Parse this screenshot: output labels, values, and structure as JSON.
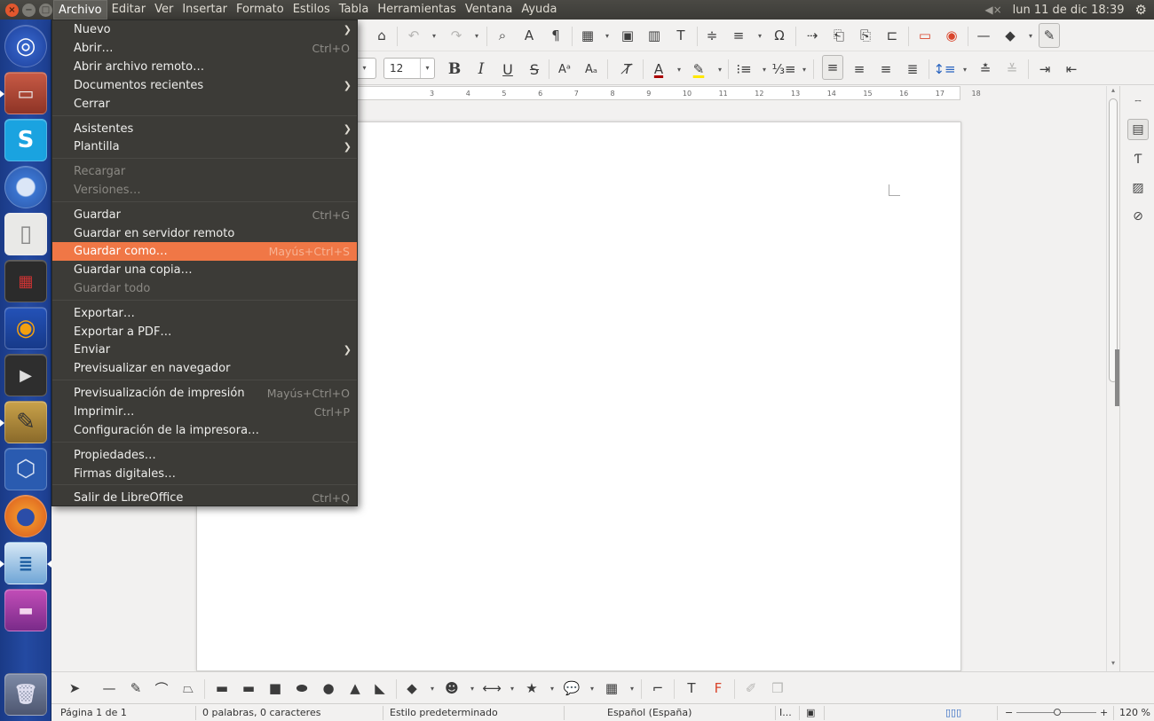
{
  "topbar": {
    "menus": [
      "Archivo",
      "Editar",
      "Ver",
      "Insertar",
      "Formato",
      "Estilos",
      "Tabla",
      "Herramientas",
      "Ventana",
      "Ayuda"
    ],
    "clock": "lun 11 de dic 18:39"
  },
  "launcher": {
    "apps": [
      "ubuntu-dash",
      "files",
      "skype",
      "chromium",
      "text-editor",
      "video-editor",
      "audacity",
      "video-player",
      "gimp",
      "virtualbox",
      "firefox",
      "libreoffice-writer",
      "libreoffice-impress",
      "trash"
    ]
  },
  "toolbar": {
    "font_size": "12"
  },
  "ruler": {
    "ticks": [
      "3",
      "4",
      "5",
      "6",
      "7",
      "8",
      "9",
      "10",
      "11",
      "12",
      "13",
      "14",
      "15",
      "16",
      "17",
      "18"
    ]
  },
  "file_menu": {
    "items": [
      {
        "label": "Nuevo",
        "submenu": true
      },
      {
        "label": "Abrir…",
        "shortcut": "Ctrl+O"
      },
      {
        "label": "Abrir archivo remoto…"
      },
      {
        "label": "Documentos recientes",
        "submenu": true
      },
      {
        "label": "Cerrar"
      },
      {
        "label": "Asistentes",
        "submenu": true
      },
      {
        "label": "Plantilla",
        "submenu": true
      },
      {
        "label": "Recargar",
        "disabled": true
      },
      {
        "label": "Versiones…",
        "disabled": true
      },
      {
        "label": "Guardar",
        "shortcut": "Ctrl+G"
      },
      {
        "label": "Guardar en servidor remoto"
      },
      {
        "label": "Guardar como…",
        "shortcut": "Mayús+Ctrl+S",
        "highlighted": true
      },
      {
        "label": "Guardar una copia…"
      },
      {
        "label": "Guardar todo",
        "disabled": true
      },
      {
        "label": "Exportar…"
      },
      {
        "label": "Exportar a PDF…"
      },
      {
        "label": "Enviar",
        "submenu": true
      },
      {
        "label": "Previsualizar en navegador"
      },
      {
        "label": "Previsualización de impresión",
        "shortcut": "Mayús+Ctrl+O"
      },
      {
        "label": "Imprimir…",
        "shortcut": "Ctrl+P"
      },
      {
        "label": "Configuración de la impresora…"
      },
      {
        "label": "Propiedades…"
      },
      {
        "label": "Firmas digitales…"
      },
      {
        "label": "Salir de LibreOffice",
        "shortcut": "Ctrl+Q"
      }
    ]
  },
  "status": {
    "page": "Página 1 de 1",
    "words": "0 palabras, 0 caracteres",
    "style": "Estilo predeterminado",
    "language": "Español (España)",
    "zoom_minus": "−",
    "zoom_plus": "+",
    "zoom": "120 %"
  },
  "colors": {
    "menu_bg": "#3c3b37",
    "highlight": "#f07746",
    "launcher": "#244aa2"
  }
}
